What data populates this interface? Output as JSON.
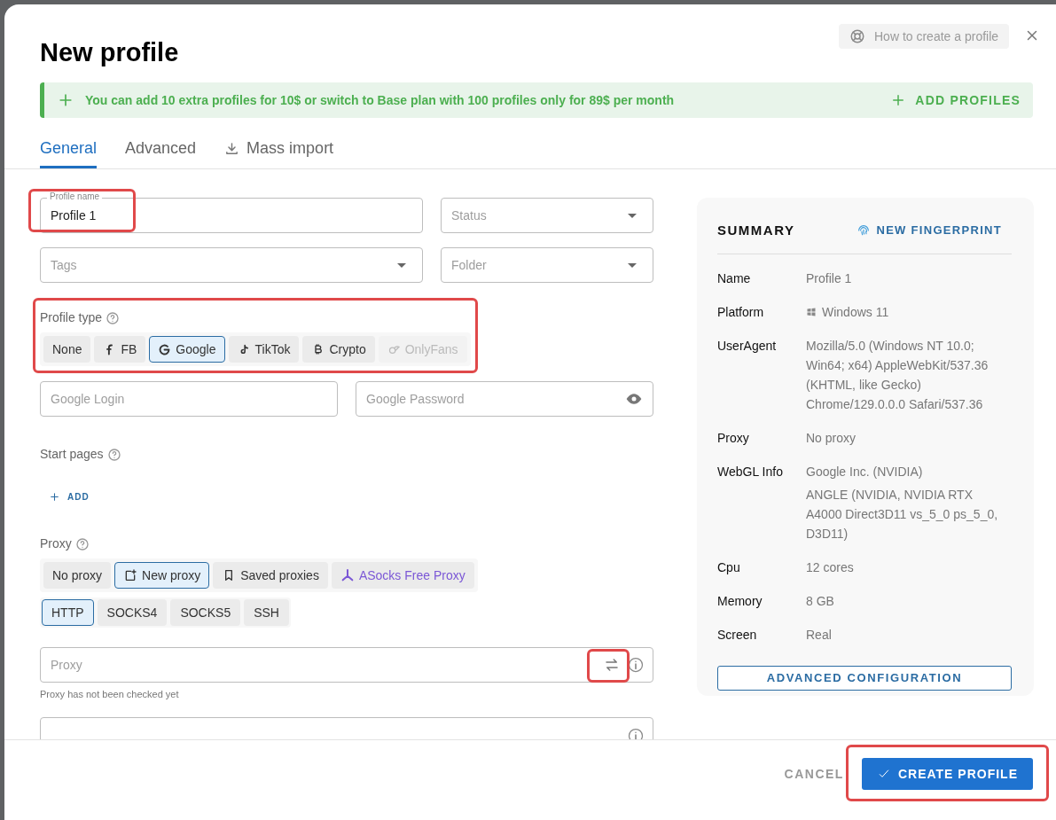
{
  "dialog": {
    "title": "New profile",
    "help_button": "How to create a profile"
  },
  "banner": {
    "message": "You can add 10 extra profiles for 10$ or switch to Base plan with 100 profiles only for 89$ per month",
    "action": "ADD PROFILES"
  },
  "tabs": [
    {
      "label": "General",
      "selected": true,
      "kind": "plain"
    },
    {
      "label": "Advanced",
      "selected": false,
      "kind": "plain"
    },
    {
      "label": "Mass import",
      "selected": false,
      "kind": "download"
    }
  ],
  "fields": {
    "profile_name": {
      "label": "Profile name",
      "value": "Profile 1",
      "highlighted": true
    },
    "status": {
      "placeholder": "Status"
    },
    "tags": {
      "placeholder": "Tags"
    },
    "folder": {
      "placeholder": "Folder"
    }
  },
  "profile_type": {
    "label": "Profile type",
    "highlighted": true,
    "options": [
      {
        "label": "None",
        "kind": "none",
        "selected": false,
        "disabled": false
      },
      {
        "label": "FB",
        "kind": "facebook",
        "selected": false,
        "disabled": false
      },
      {
        "label": "Google",
        "kind": "google",
        "selected": true,
        "disabled": false
      },
      {
        "label": "TikTok",
        "kind": "tiktok",
        "selected": false,
        "disabled": false
      },
      {
        "label": "Crypto",
        "kind": "crypto",
        "selected": false,
        "disabled": false
      },
      {
        "label": "OnlyFans",
        "kind": "onlyfans",
        "selected": false,
        "disabled": true
      }
    ]
  },
  "credentials": {
    "login": {
      "placeholder": "Google Login"
    },
    "password": {
      "placeholder": "Google Password"
    }
  },
  "start_pages": {
    "label": "Start pages",
    "add": "ADD"
  },
  "proxy": {
    "label": "Proxy",
    "sources": [
      {
        "label": "No proxy",
        "kind": "none",
        "selected": false
      },
      {
        "label": "New proxy",
        "kind": "new",
        "selected": true
      },
      {
        "label": "Saved proxies",
        "kind": "saved",
        "selected": false
      },
      {
        "label": "ASocks Free Proxy",
        "kind": "asocks",
        "selected": false
      }
    ],
    "protocols": [
      {
        "label": "HTTP",
        "selected": true
      },
      {
        "label": "SOCKS4",
        "selected": false
      },
      {
        "label": "SOCKS5",
        "selected": false
      },
      {
        "label": "SSH",
        "selected": false
      }
    ],
    "field": {
      "placeholder": "Proxy",
      "swap_highlighted": true
    },
    "hint": "Proxy has not been checked yet"
  },
  "summary": {
    "title": "SUMMARY",
    "action": "NEW FINGERPRINT",
    "rows": [
      {
        "label": "Name",
        "values": [
          "Profile 1"
        ]
      },
      {
        "label": "Platform",
        "values": [
          "Windows 11"
        ],
        "kind": "windows"
      },
      {
        "label": "UserAgent",
        "values": [
          "Mozilla/5.0 (Windows NT 10.0; Win64; x64) AppleWebKit/537.36 (KHTML, like Gecko) Chrome/129.0.0.0 Safari/537.36"
        ]
      },
      {
        "label": "Proxy",
        "values": [
          "No proxy"
        ]
      },
      {
        "label": "WebGL Info",
        "values": [
          "Google Inc. (NVIDIA)",
          "ANGLE (NVIDIA, NVIDIA RTX A4000 Direct3D11 vs_5_0 ps_5_0, D3D11)"
        ]
      },
      {
        "label": "Cpu",
        "values": [
          "12 cores"
        ]
      },
      {
        "label": "Memory",
        "values": [
          "8 GB"
        ]
      },
      {
        "label": "Screen",
        "values": [
          "Real"
        ]
      }
    ],
    "button": "ADVANCED CONFIGURATION"
  },
  "footer": {
    "cancel": "CANCEL",
    "submit": {
      "label": "CREATE PROFILE",
      "highlighted": true
    }
  }
}
